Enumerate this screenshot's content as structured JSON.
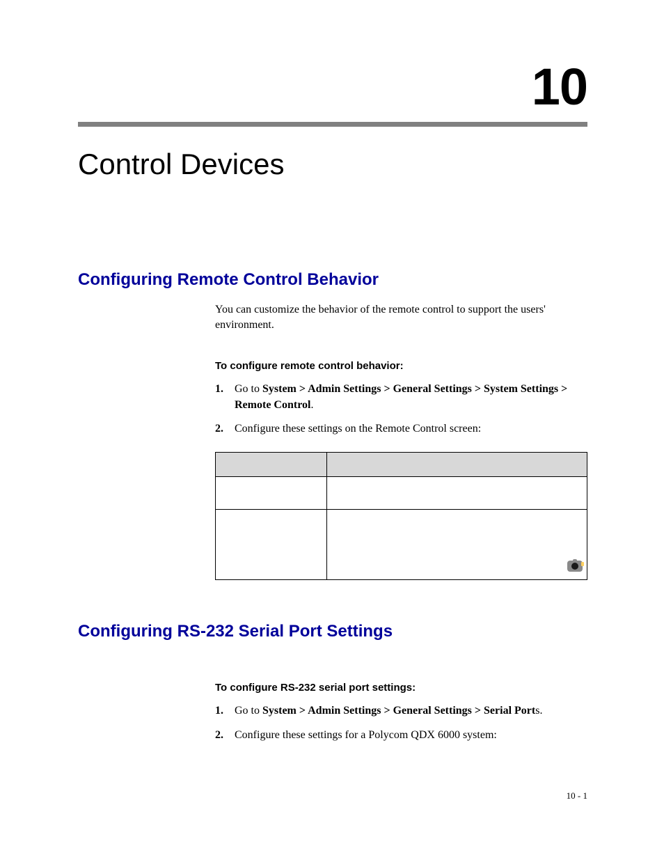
{
  "chapter": {
    "number": "10",
    "title": "Control Devices"
  },
  "section1": {
    "heading": "Configuring Remote Control Behavior",
    "intro": "You can customize the behavior of the remote control to support the users' environment.",
    "taskHeading": "To configure remote control behavior:",
    "step1_num": "1.",
    "step1_pre": "Go to ",
    "step1_bold": "System > Admin Settings > General Settings > System Settings > Remote Control",
    "step1_post": ".",
    "step2_num": "2.",
    "step2_text": "Configure these settings on the Remote Control screen:"
  },
  "section2": {
    "heading": "Configuring RS-232 Serial Port Settings",
    "taskHeading": "To configure RS-232 serial port settings:",
    "step1_num": "1.",
    "step1_pre": "Go to ",
    "step1_bold": "System > Admin Settings > General Settings > Serial Port",
    "step1_post": "s.",
    "step2_num": "2.",
    "step2_text": "Configure these settings for a Polycom QDX 6000 system:"
  },
  "footer": "10 - 1"
}
